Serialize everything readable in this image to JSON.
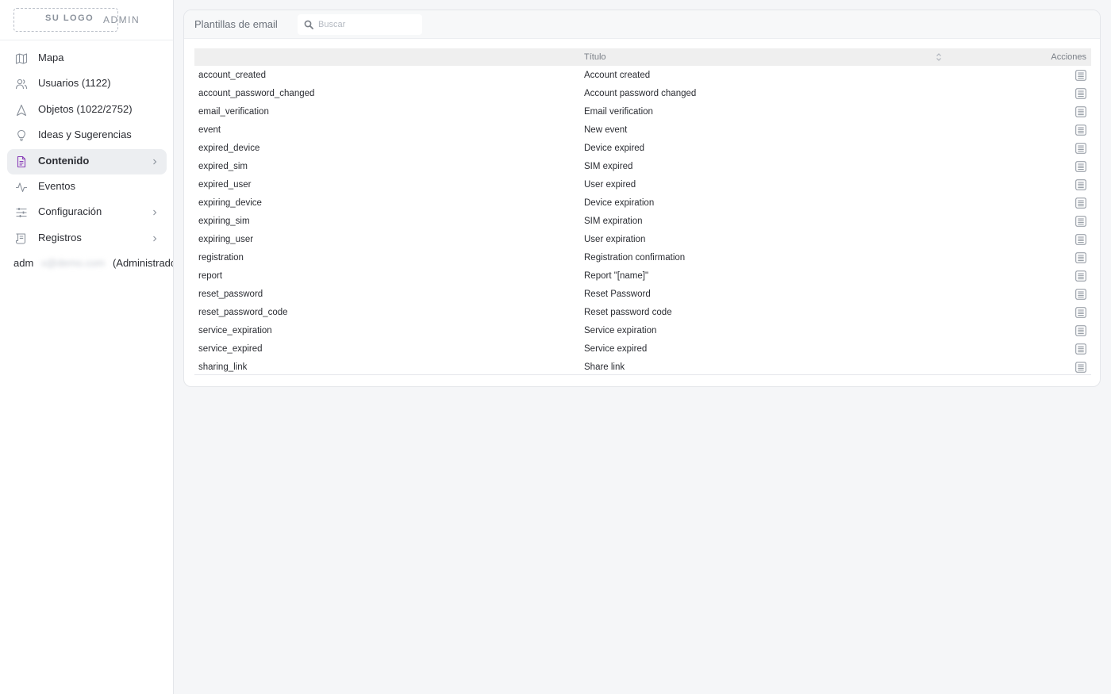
{
  "logo": {
    "text": "SU LOGO",
    "admin": "ADMIN"
  },
  "sidebar": {
    "items": [
      {
        "label": "Mapa",
        "icon": "map-icon"
      },
      {
        "label": "Usuarios (1122)",
        "icon": "users-icon"
      },
      {
        "label": "Objetos (1022/2752)",
        "icon": "navigation-icon"
      },
      {
        "label": "Ideas y Sugerencias",
        "icon": "lightbulb-icon"
      },
      {
        "label": "Contenido",
        "icon": "document-icon",
        "active": true,
        "chevron": true
      },
      {
        "label": "Eventos",
        "icon": "activity-icon"
      },
      {
        "label": "Configuración",
        "icon": "sliders-icon",
        "chevron": true
      },
      {
        "label": "Registros",
        "icon": "scroll-icon",
        "chevron": true
      }
    ],
    "user": {
      "name": "adm",
      "email": "x@demo.com",
      "role": "(Administrador)"
    }
  },
  "panel": {
    "title": "Plantillas de email",
    "search": {
      "placeholder": "Buscar"
    },
    "columns": {
      "title": "Título",
      "actions": "Acciones"
    },
    "rows": [
      {
        "key": "account_created",
        "title": "Account created"
      },
      {
        "key": "account_password_changed",
        "title": "Account password changed"
      },
      {
        "key": "email_verification",
        "title": "Email verification"
      },
      {
        "key": "event",
        "title": "New event"
      },
      {
        "key": "expired_device",
        "title": "Device expired"
      },
      {
        "key": "expired_sim",
        "title": "SIM expired"
      },
      {
        "key": "expired_user",
        "title": "User expired"
      },
      {
        "key": "expiring_device",
        "title": "Device expiration"
      },
      {
        "key": "expiring_sim",
        "title": "SIM expiration"
      },
      {
        "key": "expiring_user",
        "title": "User expiration"
      },
      {
        "key": "registration",
        "title": "Registration confirmation"
      },
      {
        "key": "report",
        "title": "Report \"[name]\""
      },
      {
        "key": "reset_password",
        "title": "Reset Password"
      },
      {
        "key": "reset_password_code",
        "title": "Reset password code"
      },
      {
        "key": "service_expiration",
        "title": "Service expiration"
      },
      {
        "key": "service_expired",
        "title": "Service expired"
      },
      {
        "key": "sharing_link",
        "title": "Share link"
      }
    ]
  },
  "colors": {
    "accent": "#8a3fb8",
    "icon": "#8b929c"
  }
}
